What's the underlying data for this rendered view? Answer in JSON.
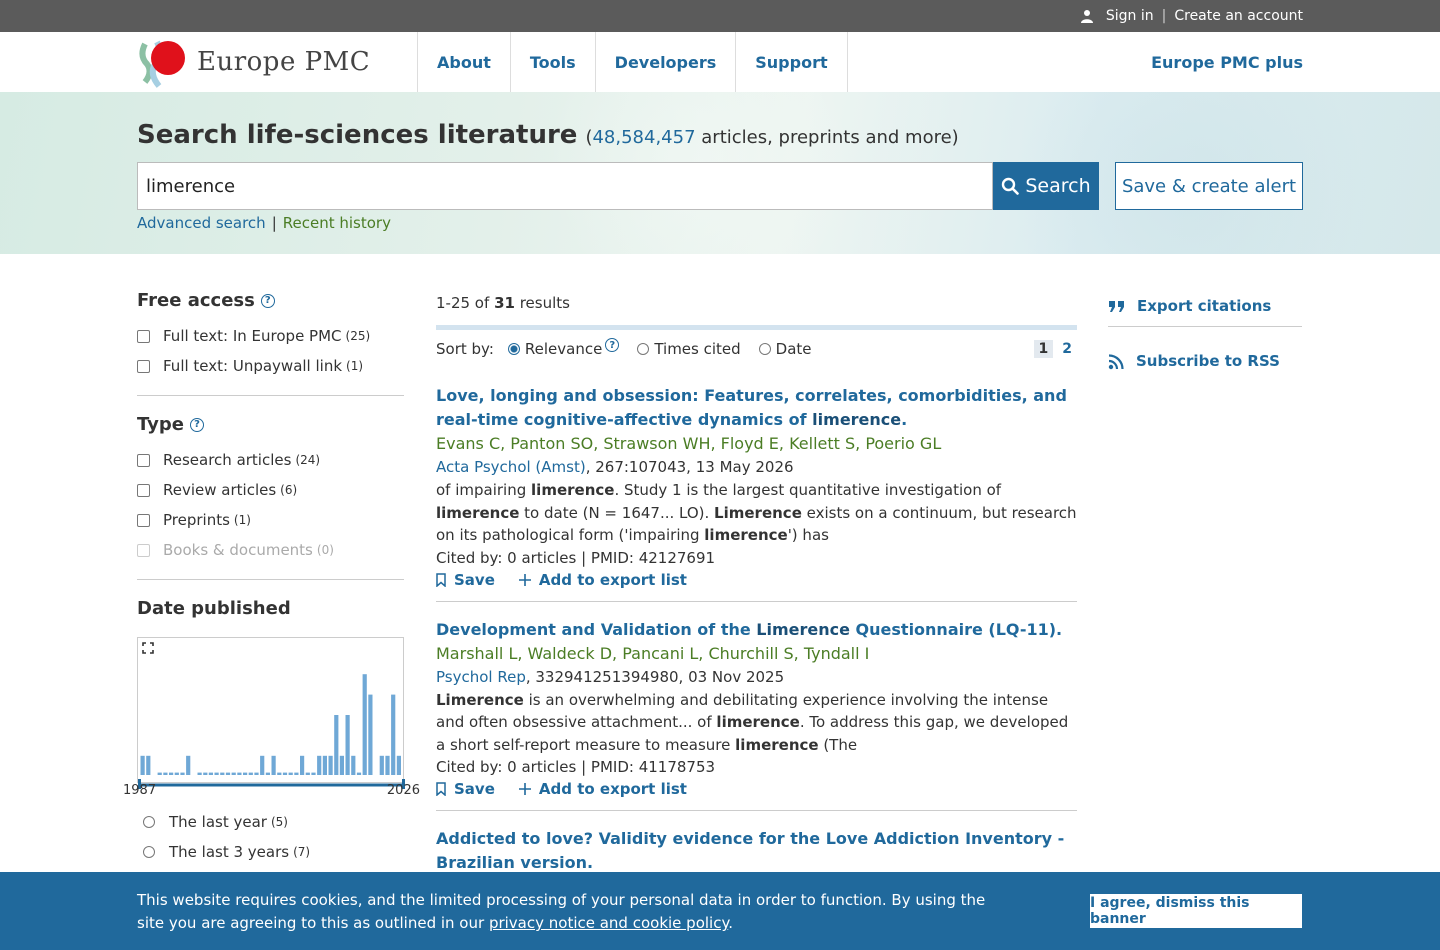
{
  "topbar": {
    "sign_in": "Sign in",
    "separator": "|",
    "create_account": "Create an account"
  },
  "header": {
    "logo_text": "Europe PMC",
    "nav": [
      "About",
      "Tools",
      "Developers",
      "Support"
    ],
    "plus_link": "Europe PMC plus"
  },
  "hero": {
    "title": "Search life-sciences literature",
    "count": "48,584,457",
    "count_suffix": "articles, preprints and more)",
    "count_prefix": "(",
    "search_value": "limerence",
    "search_button": "Search",
    "alert_button": "Save & create alert",
    "advanced_search": "Advanced search",
    "link_sep": "|",
    "recent_history": "Recent history"
  },
  "facets": {
    "free_access": {
      "title": "Free access",
      "items": [
        {
          "label": "Full text: In Europe PMC",
          "count": "(25)"
        },
        {
          "label": "Full text: Unpaywall link",
          "count": "(1)"
        }
      ]
    },
    "type": {
      "title": "Type",
      "items": [
        {
          "label": "Research articles",
          "count": "(24)"
        },
        {
          "label": "Review articles",
          "count": "(6)"
        },
        {
          "label": "Preprints",
          "count": "(1)"
        },
        {
          "label": "Books & documents",
          "count": "(0)"
        }
      ]
    },
    "date": {
      "title": "Date published",
      "year_start": "1987",
      "year_end": "2026",
      "histogram_levels": [
        0.16,
        0.16,
        0,
        0.02,
        0.02,
        0.02,
        0.02,
        0.02,
        0.16,
        0,
        0.02,
        0.02,
        0.02,
        0.02,
        0.02,
        0.02,
        0.02,
        0.02,
        0.02,
        0.02,
        0.02,
        0.16,
        0.02,
        0.16,
        0.02,
        0.02,
        0.02,
        0.02,
        0.16,
        0.02,
        0.02,
        0.16,
        0.16,
        0.16,
        0.5,
        0.16,
        0.5,
        0.16,
        0.02,
        0.84,
        0.67,
        0,
        0.16,
        0.16,
        0.67,
        0.16
      ],
      "options": [
        {
          "label": "The last year",
          "count": "(5)"
        },
        {
          "label": "The last 3 years",
          "count": "(7)"
        }
      ]
    }
  },
  "results": {
    "range": "1-25 of",
    "total": "31",
    "suffix": "results",
    "sort_label": "Sort by:",
    "sort_options": [
      "Relevance",
      "Times cited",
      "Date"
    ],
    "pages": [
      "1",
      "2"
    ],
    "items": [
      {
        "title_pre": "Love, longing and obsession: Features, correlates, comorbidities, and real-time cognitive-affective dynamics of",
        "title_hl": "limerence",
        "title_post": ".",
        "authors": "Evans C, Panton SO, Strawson WH, Floyd E, Kellett S, Poerio GL",
        "journal": "Acta Psychol (Amst)",
        "journal_rest": ", 267:107043, 13 May 2026",
        "snippet": [
          {
            "t": "of impairing ",
            "b": false
          },
          {
            "t": "limerence",
            "b": true
          },
          {
            "t": ". Study 1 is the largest quantitative investigation of ",
            "b": false
          },
          {
            "t": "limerence",
            "b": true
          },
          {
            "t": " to date (N = 1647... LO). ",
            "b": false
          },
          {
            "t": "Limerence",
            "b": true
          },
          {
            "t": " exists on a continuum, but research on its pathological form ('impairing ",
            "b": false
          },
          {
            "t": "limerence",
            "b": true
          },
          {
            "t": "') has",
            "b": false
          }
        ],
        "cited": "Cited by: 0 articles | PMID: 42127691",
        "save": "Save",
        "export": "Add to export list"
      },
      {
        "title_pre": "Development and Validation of the",
        "title_hl": "Limerence",
        "title_post": "Questionnaire (LQ-11).",
        "authors": "Marshall L, Waldeck D, Pancani L, Churchill S, Tyndall I",
        "journal": "Psychol Rep",
        "journal_rest": ", 332941251394980, 03 Nov 2025",
        "snippet": [
          {
            "t": "Limerence",
            "b": true
          },
          {
            "t": " is an overwhelming and debilitating experience involving the intense and often obsessive attachment... of ",
            "b": false
          },
          {
            "t": "limerence",
            "b": true
          },
          {
            "t": ". To address this gap, we developed a short self-report measure to measure ",
            "b": false
          },
          {
            "t": "limerence",
            "b": true
          },
          {
            "t": " (The",
            "b": false
          }
        ],
        "cited": "Cited by: 0 articles | PMID: 41178753",
        "save": "Save",
        "export": "Add to export list"
      },
      {
        "title_pre": "Addicted to love? Validity evidence for the Love Addiction Inventory - Brazilian version.",
        "title_hl": "",
        "title_post": ""
      }
    ]
  },
  "sidebar": {
    "export": "Export citations",
    "rss": "Subscribe to RSS"
  },
  "cookie": {
    "text": "This website requires cookies, and the limited processing of your personal data in order to function. By using the site you are agreeing to this as outlined in our",
    "link": "privacy notice and cookie policy",
    "end": ".",
    "button": "I agree, dismiss this banner"
  },
  "colors": {
    "primary": "#20699c",
    "author_green": "#4b7d25",
    "topbar": "#5b5b5b",
    "bar": "#6fa8d6"
  }
}
